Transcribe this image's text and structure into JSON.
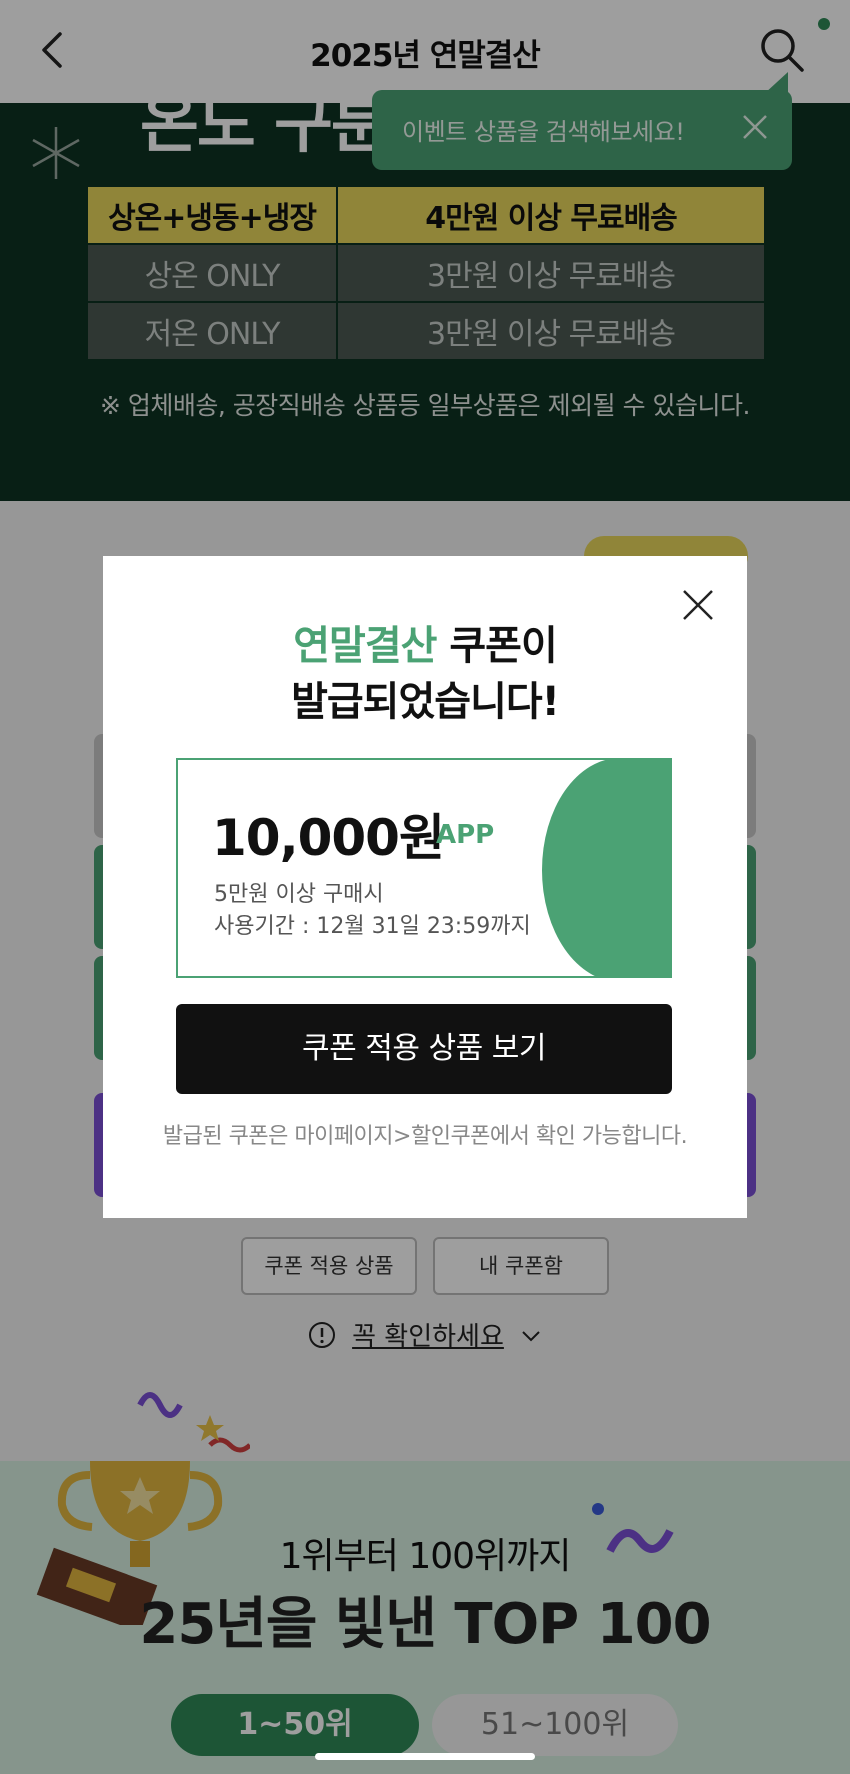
{
  "header": {
    "title": "2025년 연말결산"
  },
  "tooltip": {
    "text": "이벤트 상품을 검색해보세요!"
  },
  "banner": {
    "headline": "온도 구분",
    "shipping_table": [
      {
        "zone": "상온+냉동+냉장",
        "condition": "4만원 이상 무료배송",
        "highlight": true
      },
      {
        "zone": "상온 ONLY",
        "condition": "3만원 이상 무료배송",
        "highlight": false
      },
      {
        "zone": "저온 ONLY",
        "condition": "3만원 이상 무료배송",
        "highlight": false
      }
    ],
    "note": "※ 업체배송, 공장직배송 상품등 일부상품은 제외될 수 있습니다."
  },
  "coupon_links": {
    "applicable_products": "쿠폰 적용 상품",
    "my_coupons": "내 쿠폰함"
  },
  "notice": {
    "label": "꼭 확인하세요"
  },
  "top100": {
    "subtitle": "1위부터 100위까지",
    "title": "25년을 빛낸 TOP 100",
    "tabs": [
      {
        "label": "1~50위",
        "active": true
      },
      {
        "label": "51~100위",
        "active": false
      }
    ]
  },
  "modal": {
    "title_accent": "연말결산",
    "title_rest": " 쿠폰이",
    "title_line2": "발급되었습니다!",
    "coupon": {
      "amount": "10,000원",
      "platform": "APP",
      "condition": "5만원 이상 구매시",
      "period": "사용기간 : 12월 31일 23:59까지"
    },
    "button_label": "쿠폰 적용 상품 보기",
    "note": "발급된 쿠폰은 마이페이지>할인쿠폰에서 확인 가능합니다."
  },
  "colors": {
    "brand_green": "#4ba274",
    "dark_green": "#0d3322",
    "highlight_yellow": "#e8d75c",
    "purple": "#7b4fd6"
  }
}
